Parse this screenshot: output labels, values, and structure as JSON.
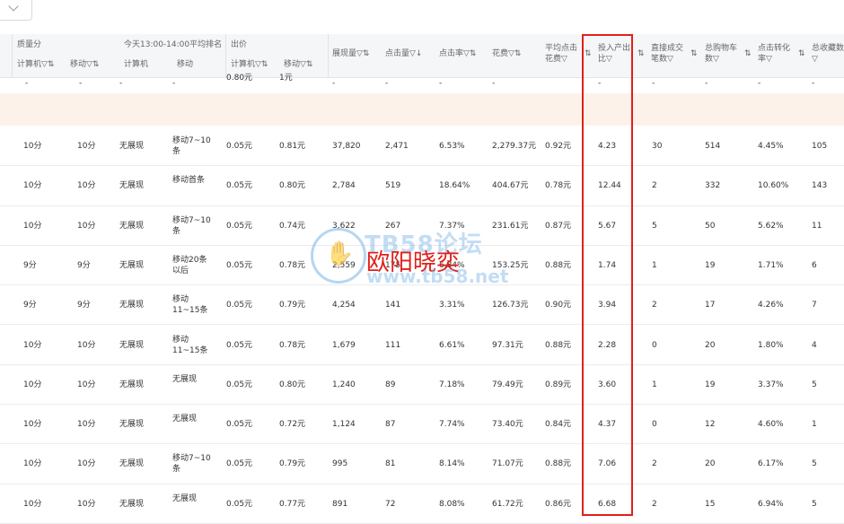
{
  "header": {
    "groups": {
      "quality": "质量分",
      "rank": "今天13:00-14:00平均排名",
      "bid": "出价"
    },
    "quality_pc": "计算机▽⇅",
    "quality_mobile": "移动▽⇅",
    "rank_pc": "计算机",
    "rank_mobile": "移动",
    "bid_pc": "计算机▽⇅",
    "bid_mobile": "移动▽⇅",
    "impressions": "展现量▽⇅",
    "clicks": "点击量▽↓",
    "ctr": "点击率▽⇅",
    "cost": "花费▽⇅",
    "avg_cpc": "平均点击花费▽",
    "roi": "投入产出比▽",
    "direct_deals": "直接成交笔数▽",
    "cart": "总购物车数▽",
    "cvr": "点击转化率▽",
    "fav": "总收藏数▽",
    "sort_icon": "⇅"
  },
  "top_row": {
    "dashes": [
      "-",
      "-",
      "-",
      "-"
    ],
    "bid_pc": "0.80元",
    "bid_mobile": "1元",
    "dashes2": [
      "-",
      "-",
      "-",
      "-",
      "-",
      "-",
      "-",
      "-",
      "-"
    ]
  },
  "rows": [
    {
      "q_pc": "10分",
      "q_m": "10分",
      "r_pc": "无展现",
      "r_m": "移动7~10条",
      "b_pc": "0.05元",
      "b_m": "0.81元",
      "imp": "37,820",
      "clk": "2,471",
      "ctr": "6.53%",
      "cost": "2,279.37元",
      "cpc": "0.92元",
      "roi": "4.23",
      "deals": "30",
      "cart": "514",
      "cvr": "4.45%",
      "fav": "105"
    },
    {
      "q_pc": "10分",
      "q_m": "10分",
      "r_pc": "无展现",
      "r_m": "移动首条",
      "b_pc": "0.05元",
      "b_m": "0.80元",
      "imp": "2,784",
      "clk": "519",
      "ctr": "18.64%",
      "cost": "404.67元",
      "cpc": "0.78元",
      "roi": "12.44",
      "deals": "2",
      "cart": "332",
      "cvr": "10.60%",
      "fav": "143"
    },
    {
      "q_pc": "10分",
      "q_m": "10分",
      "r_pc": "无展现",
      "r_m": "移动7~10条",
      "b_pc": "0.05元",
      "b_m": "0.74元",
      "imp": "3,622",
      "clk": "267",
      "ctr": "7.37%",
      "cost": "231.61元",
      "cpc": "0.87元",
      "roi": "5.67",
      "deals": "5",
      "cart": "50",
      "cvr": "5.62%",
      "fav": "11"
    },
    {
      "q_pc": "9分",
      "q_m": "9分",
      "r_pc": "无展现",
      "r_m": "移动20条以后",
      "b_pc": "0.05元",
      "b_m": "0.78元",
      "imp": "2,559",
      "clk": "175",
      "ctr": "6.84%",
      "cost": "153.25元",
      "cpc": "0.88元",
      "roi": "1.74",
      "deals": "1",
      "cart": "19",
      "cvr": "1.71%",
      "fav": "6"
    },
    {
      "q_pc": "9分",
      "q_m": "9分",
      "r_pc": "无展现",
      "r_m": "移动11~15条",
      "b_pc": "0.05元",
      "b_m": "0.79元",
      "imp": "4,254",
      "clk": "141",
      "ctr": "3.31%",
      "cost": "126.73元",
      "cpc": "0.90元",
      "roi": "3.94",
      "deals": "2",
      "cart": "17",
      "cvr": "4.26%",
      "fav": "7"
    },
    {
      "q_pc": "10分",
      "q_m": "10分",
      "r_pc": "无展现",
      "r_m": "移动11~15条",
      "b_pc": "0.05元",
      "b_m": "0.78元",
      "imp": "1,679",
      "clk": "111",
      "ctr": "6.61%",
      "cost": "97.31元",
      "cpc": "0.88元",
      "roi": "2.28",
      "deals": "0",
      "cart": "20",
      "cvr": "1.80%",
      "fav": "4"
    },
    {
      "q_pc": "10分",
      "q_m": "10分",
      "r_pc": "无展现",
      "r_m": "无展现",
      "b_pc": "0.05元",
      "b_m": "0.80元",
      "imp": "1,240",
      "clk": "89",
      "ctr": "7.18%",
      "cost": "79.49元",
      "cpc": "0.89元",
      "roi": "3.60",
      "deals": "1",
      "cart": "19",
      "cvr": "3.37%",
      "fav": "5"
    },
    {
      "q_pc": "10分",
      "q_m": "10分",
      "r_pc": "无展现",
      "r_m": "无展现",
      "b_pc": "0.05元",
      "b_m": "0.72元",
      "imp": "1,124",
      "clk": "87",
      "ctr": "7.74%",
      "cost": "73.40元",
      "cpc": "0.84元",
      "roi": "4.37",
      "deals": "0",
      "cart": "12",
      "cvr": "4.60%",
      "fav": "1"
    },
    {
      "q_pc": "10分",
      "q_m": "10分",
      "r_pc": "无展现",
      "r_m": "移动7~10条",
      "b_pc": "0.05元",
      "b_m": "0.79元",
      "imp": "995",
      "clk": "81",
      "ctr": "8.14%",
      "cost": "71.07元",
      "cpc": "0.88元",
      "roi": "7.06",
      "deals": "2",
      "cart": "20",
      "cvr": "6.17%",
      "fav": "5"
    },
    {
      "q_pc": "10分",
      "q_m": "10分",
      "r_pc": "无展现",
      "r_m": "无展现",
      "b_pc": "0.05元",
      "b_m": "0.77元",
      "imp": "891",
      "clk": "72",
      "ctr": "8.08%",
      "cost": "61.72元",
      "cpc": "0.86元",
      "roi": "6.68",
      "deals": "2",
      "cart": "15",
      "cvr": "6.94%",
      "fav": "5"
    }
  ],
  "watermark": {
    "site": "TB58论坛",
    "url": "www.tb58.net",
    "author": "欧阳晓奕",
    "logo_icon": "hand-icon"
  },
  "colors": {
    "highlight": "#e0201b",
    "band": "#fdf2ea",
    "header_bg": "#f5f6f8"
  }
}
